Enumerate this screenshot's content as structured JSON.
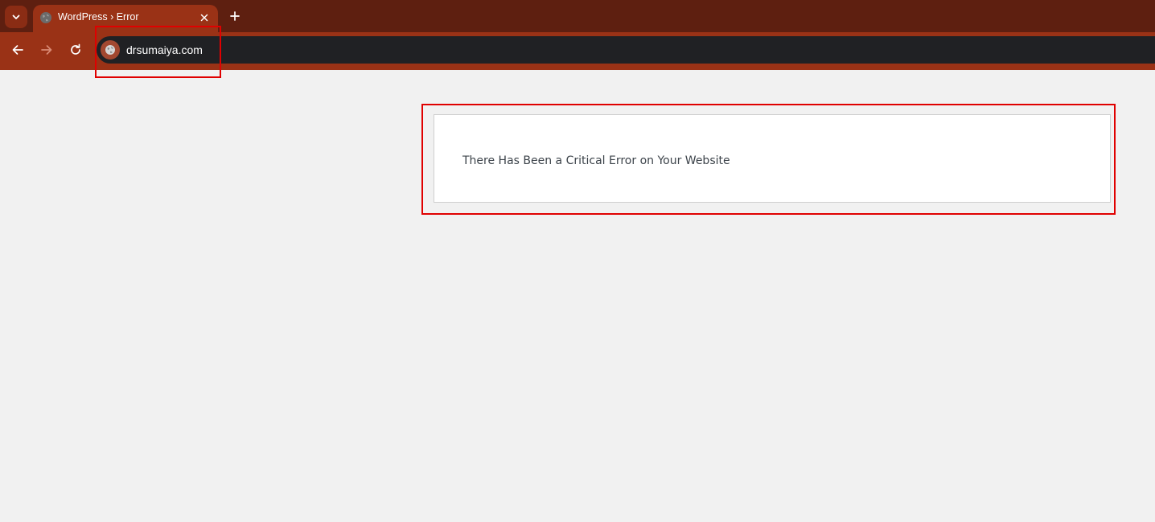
{
  "colors": {
    "tab_strip_bg": "#5e1f10",
    "tab_bg": "#9a3216",
    "omnibox_bg": "#202124",
    "highlight": "#e00000",
    "page_bg": "#f1f1f1"
  },
  "tab_strip": {
    "tab_search_icon": "chevron-down-icon",
    "tabs": [
      {
        "title": "WordPress › Error",
        "favicon": "globe-icon",
        "close_icon": "close-icon"
      }
    ],
    "new_tab_icon": "plus-icon"
  },
  "toolbar": {
    "back_icon": "arrow-left-icon",
    "forward_icon": "arrow-right-icon",
    "reload_icon": "reload-icon",
    "site_info_icon": "globe-icon",
    "url": "drsumaiya.com"
  },
  "page": {
    "error_message": "There Has Been a Critical Error on Your Website"
  }
}
